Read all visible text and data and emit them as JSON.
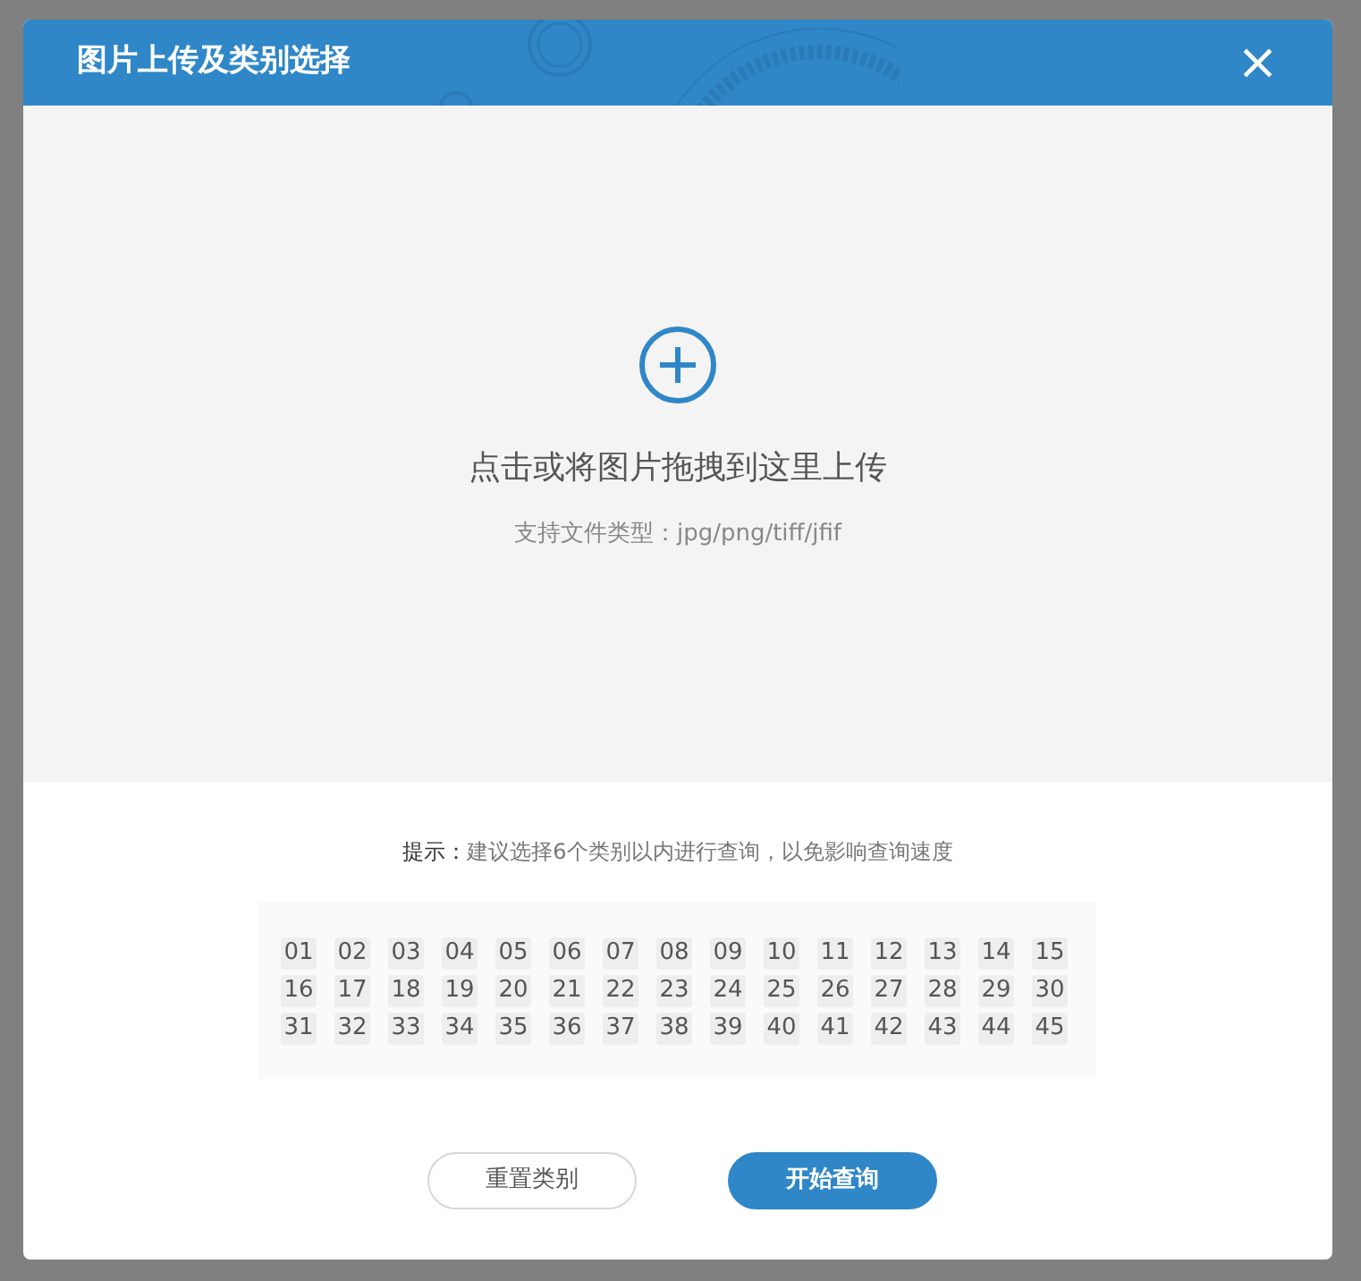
{
  "dialog": {
    "title": "图片上传及类别选择",
    "close": "×"
  },
  "upload": {
    "prompt": "点击或将图片拖拽到这里上传",
    "formats": "支持文件类型：jpg/png/tiff/jfif"
  },
  "hint": {
    "label": "提示：",
    "text": "建议选择6个类别以内进行查询，以免影响查询速度"
  },
  "categories": [
    {
      "label": "01",
      "selected": false
    },
    {
      "label": "02",
      "selected": false
    },
    {
      "label": "03",
      "selected": false
    },
    {
      "label": "04",
      "selected": false
    },
    {
      "label": "05",
      "selected": false
    },
    {
      "label": "06",
      "selected": false
    },
    {
      "label": "07",
      "selected": false
    },
    {
      "label": "08",
      "selected": false
    },
    {
      "label": "09",
      "selected": false
    },
    {
      "label": "10",
      "selected": false
    },
    {
      "label": "11",
      "selected": false
    },
    {
      "label": "12",
      "selected": false
    },
    {
      "label": "13",
      "selected": false
    },
    {
      "label": "14",
      "selected": false
    },
    {
      "label": "15",
      "selected": false
    },
    {
      "label": "16",
      "selected": false
    },
    {
      "label": "17",
      "selected": false
    },
    {
      "label": "18",
      "selected": false
    },
    {
      "label": "19",
      "selected": false
    },
    {
      "label": "20",
      "selected": false
    },
    {
      "label": "21",
      "selected": false
    },
    {
      "label": "22",
      "selected": false
    },
    {
      "label": "23",
      "selected": false
    },
    {
      "label": "24",
      "selected": false
    },
    {
      "label": "25",
      "selected": false
    },
    {
      "label": "26",
      "selected": false
    },
    {
      "label": "27",
      "selected": false
    },
    {
      "label": "28",
      "selected": false
    },
    {
      "label": "29",
      "selected": false
    },
    {
      "label": "30",
      "selected": false
    },
    {
      "label": "31",
      "selected": false
    },
    {
      "label": "32",
      "selected": false
    },
    {
      "label": "33",
      "selected": false
    },
    {
      "label": "34",
      "selected": false
    },
    {
      "label": "35",
      "selected": false
    },
    {
      "label": "36",
      "selected": false
    },
    {
      "label": "37",
      "selected": false
    },
    {
      "label": "38",
      "selected": false
    },
    {
      "label": "39",
      "selected": false
    },
    {
      "label": "40",
      "selected": false
    },
    {
      "label": "41",
      "selected": false
    },
    {
      "label": "42",
      "selected": false
    },
    {
      "label": "43",
      "selected": false
    },
    {
      "label": "44",
      "selected": false
    },
    {
      "label": "45",
      "selected": false
    }
  ],
  "buttons": [
    {
      "label": "重置类别",
      "kind": "secondary"
    },
    {
      "label": "开始查询",
      "kind": "primary"
    }
  ]
}
